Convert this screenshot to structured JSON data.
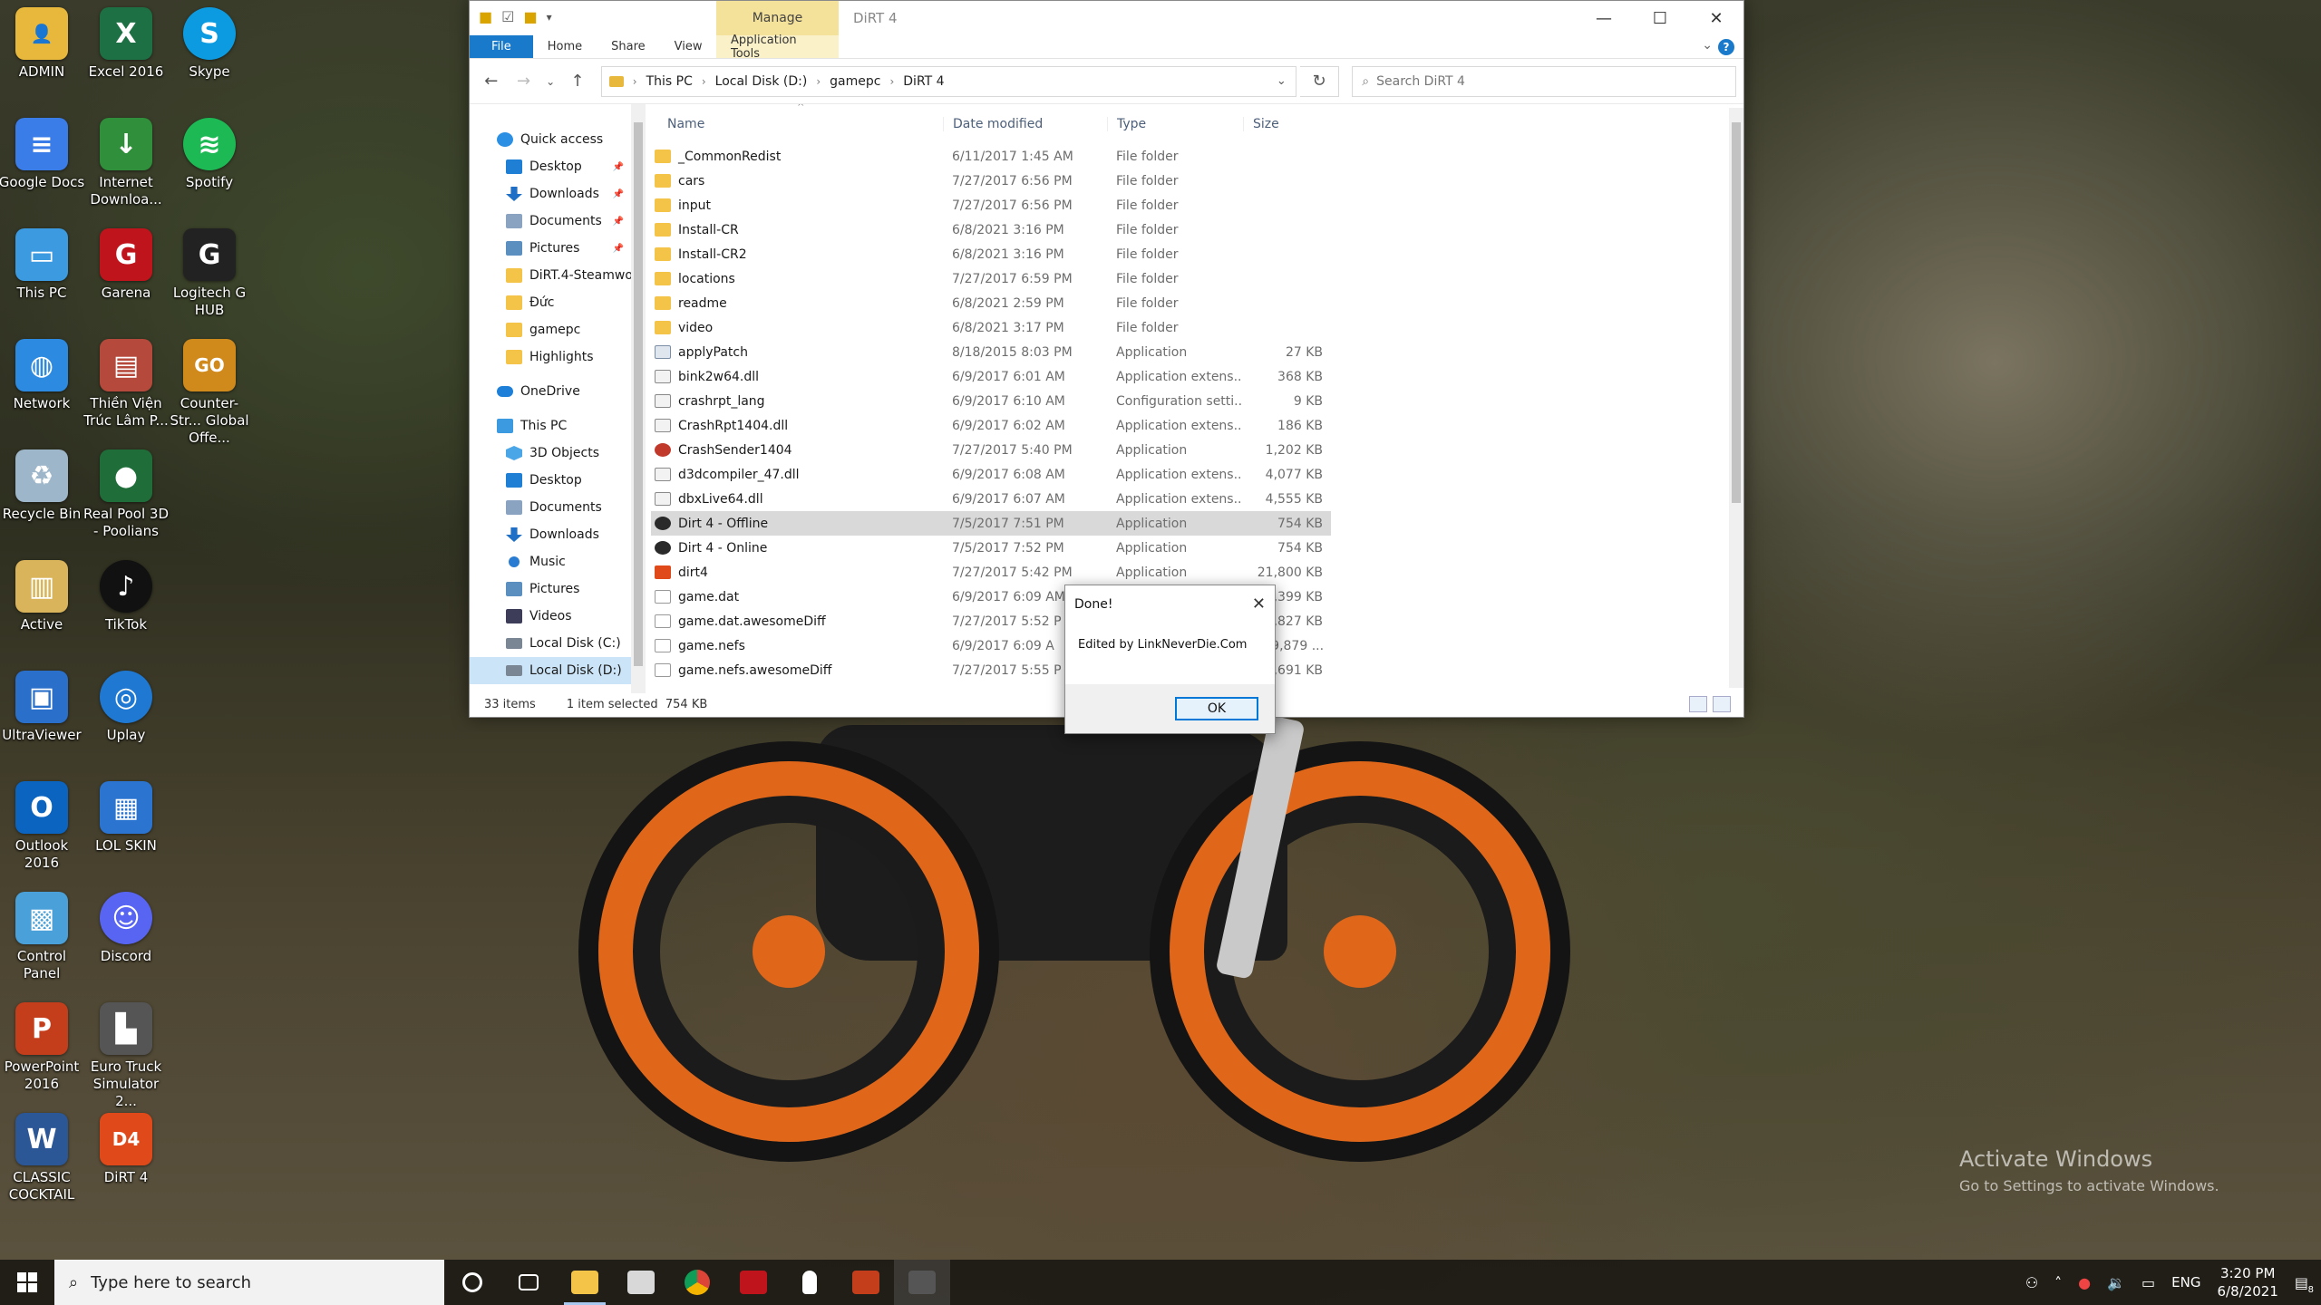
{
  "desktop_icons": [
    {
      "label": "ADMIN",
      "icon": "user-folder-icon",
      "color": "#e8b83c",
      "glyph": "👤"
    },
    {
      "label": "Excel 2016",
      "icon": "excel-icon",
      "color": "#1d7044",
      "glyph": "X"
    },
    {
      "label": "Skype",
      "icon": "skype-icon",
      "color": "#0c9be0",
      "glyph": "S"
    },
    {
      "label": "Google Docs",
      "icon": "google-docs-icon",
      "color": "#3a7de8",
      "glyph": "≡"
    },
    {
      "label": "Internet Downloa...",
      "icon": "internet-download-manager-icon",
      "color": "#2f8f3a",
      "glyph": "↓"
    },
    {
      "label": "Spotify",
      "icon": "spotify-icon",
      "color": "#1db954",
      "glyph": "≋"
    },
    {
      "label": "This PC",
      "icon": "this-pc-icon",
      "color": "#3b9ae0",
      "glyph": "▭"
    },
    {
      "label": "Garena",
      "icon": "garena-icon",
      "color": "#c0141c",
      "glyph": "G"
    },
    {
      "label": "Logitech G HUB",
      "icon": "logitech-ghub-icon",
      "color": "#222222",
      "glyph": "G"
    },
    {
      "label": "Network",
      "icon": "network-icon",
      "color": "#2c8be0",
      "glyph": "◍"
    },
    {
      "label": "Thiền Viện Trúc Lâm P...",
      "icon": "web-shortcut-icon",
      "color": "#b54a3c",
      "glyph": "▤"
    },
    {
      "label": "Counter-Str... Global Offe...",
      "icon": "csgo-icon",
      "color": "#d08a1c",
      "glyph": "GO"
    },
    {
      "label": "Recycle Bin",
      "icon": "recycle-bin-icon",
      "color": "#9db6c9",
      "glyph": "♻"
    },
    {
      "label": "Real Pool 3D - Poolians",
      "icon": "real-pool-icon",
      "color": "#1f6e3a",
      "glyph": "●"
    },
    {
      "label": "Active",
      "icon": "active-icon",
      "color": "#d9b45a",
      "glyph": "▥"
    },
    {
      "label": "TikTok",
      "icon": "tiktok-icon",
      "color": "#111111",
      "glyph": "♪"
    },
    {
      "label": "UltraViewer",
      "icon": "ultraviewer-icon",
      "color": "#2a6fc9",
      "glyph": "▣"
    },
    {
      "label": "Uplay",
      "icon": "uplay-icon",
      "color": "#1f78d1",
      "glyph": "◎"
    },
    {
      "label": "Outlook 2016",
      "icon": "outlook-icon",
      "color": "#0a64c0",
      "glyph": "O"
    },
    {
      "label": "LOL SKIN",
      "icon": "lol-skin-icon",
      "color": "#2b74d0",
      "glyph": "▦"
    },
    {
      "label": "Control Panel",
      "icon": "control-panel-icon",
      "color": "#4aa0d8",
      "glyph": "▩"
    },
    {
      "label": "Discord",
      "icon": "discord-icon",
      "color": "#5865f2",
      "glyph": "☺"
    },
    {
      "label": "PowerPoint 2016",
      "icon": "powerpoint-icon",
      "color": "#c43e1c",
      "glyph": "P"
    },
    {
      "label": "Euro Truck Simulator 2...",
      "icon": "euro-truck-icon",
      "color": "#555555",
      "glyph": "▙"
    },
    {
      "label": "CLASSIC COCKTAIL",
      "icon": "word-doc-icon",
      "color": "#2b5797",
      "glyph": "W"
    },
    {
      "label": "DiRT 4",
      "icon": "dirt4-icon",
      "color": "#e04a1a",
      "glyph": "D4"
    }
  ],
  "explorer": {
    "title": "DiRT 4",
    "manage_tab": "Manage",
    "ribbon": {
      "file": "File",
      "home": "Home",
      "share": "Share",
      "view": "View",
      "app_tools": "Application Tools"
    },
    "address": {
      "crumbs": [
        "This PC",
        "Local Disk (D:)",
        "gamepc",
        "DiRT 4"
      ]
    },
    "search_placeholder": "Search DiRT 4",
    "nav": {
      "quick_access": "Quick access",
      "quick_items": [
        {
          "label": "Desktop",
          "icon": "desktop-icon",
          "pinned": true
        },
        {
          "label": "Downloads",
          "icon": "downloads-icon",
          "pinned": true
        },
        {
          "label": "Documents",
          "icon": "documents-icon",
          "pinned": true
        },
        {
          "label": "Pictures",
          "icon": "pictures-icon",
          "pinned": true
        },
        {
          "label": "DiRT.4-Steamwo",
          "icon": "folder-icon",
          "pinned": false
        },
        {
          "label": "Đức",
          "icon": "folder-icon",
          "pinned": false
        },
        {
          "label": "gamepc",
          "icon": "folder-icon",
          "pinned": false
        },
        {
          "label": "Highlights",
          "icon": "folder-icon",
          "pinned": false
        }
      ],
      "onedrive": "OneDrive",
      "this_pc": "This PC",
      "pc_items": [
        {
          "label": "3D Objects",
          "icon": "3d-objects-icon"
        },
        {
          "label": "Desktop",
          "icon": "desktop-icon"
        },
        {
          "label": "Documents",
          "icon": "documents-icon"
        },
        {
          "label": "Downloads",
          "icon": "downloads-icon"
        },
        {
          "label": "Music",
          "icon": "music-icon"
        },
        {
          "label": "Pictures",
          "icon": "pictures-icon"
        },
        {
          "label": "Videos",
          "icon": "videos-icon"
        },
        {
          "label": "Local Disk (C:)",
          "icon": "drive-icon"
        },
        {
          "label": "Local Disk (D:)",
          "icon": "drive-icon",
          "selected": true
        }
      ]
    },
    "columns": {
      "name": "Name",
      "date": "Date modified",
      "type": "Type",
      "size": "Size"
    },
    "files": [
      {
        "name": "_CommonRedist",
        "date": "6/11/2017 1:45 AM",
        "type": "File folder",
        "size": "",
        "kind": "folder"
      },
      {
        "name": "cars",
        "date": "7/27/2017 6:56 PM",
        "type": "File folder",
        "size": "",
        "kind": "folder"
      },
      {
        "name": "input",
        "date": "7/27/2017 6:56 PM",
        "type": "File folder",
        "size": "",
        "kind": "folder"
      },
      {
        "name": "Install-CR",
        "date": "6/8/2021 3:16 PM",
        "type": "File folder",
        "size": "",
        "kind": "folder"
      },
      {
        "name": "Install-CR2",
        "date": "6/8/2021 3:16 PM",
        "type": "File folder",
        "size": "",
        "kind": "folder"
      },
      {
        "name": "locations",
        "date": "7/27/2017 6:59 PM",
        "type": "File folder",
        "size": "",
        "kind": "folder"
      },
      {
        "name": "readme",
        "date": "6/8/2021 2:59 PM",
        "type": "File folder",
        "size": "",
        "kind": "folder"
      },
      {
        "name": "video",
        "date": "6/8/2021 3:17 PM",
        "type": "File folder",
        "size": "",
        "kind": "folder"
      },
      {
        "name": "applyPatch",
        "date": "8/18/2015 8:03 PM",
        "type": "Application",
        "size": "27 KB",
        "kind": "app"
      },
      {
        "name": "bink2w64.dll",
        "date": "6/9/2017 6:01 AM",
        "type": "Application extens...",
        "size": "368 KB",
        "kind": "dll"
      },
      {
        "name": "crashrpt_lang",
        "date": "6/9/2017 6:10 AM",
        "type": "Configuration setti...",
        "size": "9 KB",
        "kind": "cfg"
      },
      {
        "name": "CrashRpt1404.dll",
        "date": "6/9/2017 6:02 AM",
        "type": "Application extens...",
        "size": "186 KB",
        "kind": "dll"
      },
      {
        "name": "CrashSender1404",
        "date": "7/27/2017 5:40 PM",
        "type": "Application",
        "size": "1,202 KB",
        "kind": "crash"
      },
      {
        "name": "d3dcompiler_47.dll",
        "date": "6/9/2017 6:08 AM",
        "type": "Application extens...",
        "size": "4,077 KB",
        "kind": "dll"
      },
      {
        "name": "dbxLive64.dll",
        "date": "6/9/2017 6:07 AM",
        "type": "Application extens...",
        "size": "4,555 KB",
        "kind": "dll"
      },
      {
        "name": "Dirt 4 - Offline",
        "date": "7/5/2017 7:51 PM",
        "type": "Application",
        "size": "754 KB",
        "kind": "dirt",
        "selected": true
      },
      {
        "name": "Dirt 4 - Online",
        "date": "7/5/2017 7:52 PM",
        "type": "Application",
        "size": "754 KB",
        "kind": "dirt"
      },
      {
        "name": "dirt4",
        "date": "7/27/2017 5:42 PM",
        "type": "Application",
        "size": "21,800 KB",
        "kind": "dirt4"
      },
      {
        "name": "game.dat",
        "date": "6/9/2017 6:09 AM",
        "type": "",
        "size": "414,399 KB",
        "kind": "dat"
      },
      {
        "name": "game.dat.awesomeDiff",
        "date": "7/27/2017 5:52 P",
        "type": "",
        "size": "2,827 KB",
        "kind": "dat"
      },
      {
        "name": "game.nefs",
        "date": "6/9/2017 6:09 A",
        "type": "",
        "size": "3,779,879 ...",
        "kind": "dat"
      },
      {
        "name": "game.nefs.awesomeDiff",
        "date": "7/27/2017 5:55 P",
        "type": "",
        "size": "307,691 KB",
        "kind": "dat"
      }
    ],
    "status": {
      "count": "33 items",
      "selection": "1 item selected  754 KB"
    }
  },
  "dialog": {
    "title": "Done!",
    "message": "Edited by LinkNeverDie.Com",
    "ok": "OK"
  },
  "watermark": {
    "line1": "Activate Windows",
    "line2": "Go to Settings to activate Windows."
  },
  "taskbar": {
    "search_placeholder": "Type here to search",
    "apps": [
      {
        "name": "cortana-icon",
        "color": "#ffffff",
        "state": ""
      },
      {
        "name": "task-view-icon",
        "color": "#ffffff",
        "state": ""
      },
      {
        "name": "file-explorer-icon",
        "color": "#f3c447",
        "state": "active"
      },
      {
        "name": "app-icon",
        "color": "#d8d8d8",
        "state": ""
      },
      {
        "name": "chrome-icon",
        "color": "#e8a21c",
        "state": ""
      },
      {
        "name": "garena-icon",
        "color": "#c0141c",
        "state": ""
      },
      {
        "name": "cursor-app-icon",
        "color": "#ffffff",
        "state": ""
      },
      {
        "name": "powerpoint-icon",
        "color": "#c43e1c",
        "state": ""
      },
      {
        "name": "dirt4-icon",
        "color": "#555555",
        "state": "hl"
      }
    ],
    "lang": "ENG",
    "time": "3:20 PM",
    "date": "6/8/2021",
    "notif_count": "8"
  }
}
